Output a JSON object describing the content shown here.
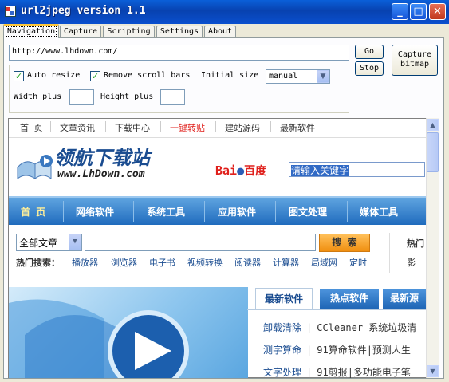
{
  "window": {
    "title": "url2jpeg version 1.1",
    "controls": {
      "minimize": "_",
      "maximize": "□",
      "close": "✕"
    }
  },
  "tabs": [
    {
      "label": "Navigation",
      "active": true
    },
    {
      "label": "Capture"
    },
    {
      "label": "Scripting"
    },
    {
      "label": "Settings"
    },
    {
      "label": "About"
    }
  ],
  "navigation": {
    "url_value": "http://www.lhdown.com/",
    "go_label": "Go",
    "stop_label": "Stop",
    "capture_label_1": "Capture",
    "capture_label_2": "bitmap",
    "auto_resize_label": "Auto resize",
    "auto_resize_checked": true,
    "remove_scroll_label": "Remove scroll bars",
    "remove_scroll_checked": true,
    "initial_size_label": "Initial size",
    "initial_size_value": "manual",
    "width_plus_label": "Width plus",
    "height_plus_label": "Height plus"
  },
  "web": {
    "top_links": [
      "首 页",
      "文章资讯",
      "下载中心",
      "一键转贴",
      "建站源码",
      "最新软件"
    ],
    "top_links_highlight_index": 3,
    "logo_title": "领航下载站",
    "logo_url": "www.LhDown.com",
    "baidu_text_1": "Bai",
    "baidu_text_2": "百度",
    "search_placeholder": "请输入关键字",
    "nav_items": [
      "首 页",
      "网络软件",
      "系统工具",
      "应用软件",
      "图文处理",
      "媒体工具"
    ],
    "category_select": "全部文章",
    "search_button": "搜 索",
    "hot_label": "热门搜索：",
    "hot_terms": [
      "播放器",
      "浏览器",
      "电子书",
      "视频转换",
      "阅读器",
      "计算器",
      "局域网",
      "定时"
    ],
    "side_hot_1": "热门",
    "side_hot_2": "影",
    "content_tabs": [
      "最新软件",
      "热点软件",
      "最新源"
    ],
    "list": [
      {
        "category": "卸载清除",
        "title": "CCleaner_系统垃圾清"
      },
      {
        "category": "测字算命",
        "title": "91算命软件|预测人生"
      },
      {
        "category": "文字处理",
        "title": "91剪报|多功能电子笔"
      }
    ]
  },
  "colors": {
    "titlebar": "#0842b0",
    "nav_blue": "#1f6bbd",
    "search_orange": "#f08f10",
    "highlight_red": "#e0201c"
  }
}
